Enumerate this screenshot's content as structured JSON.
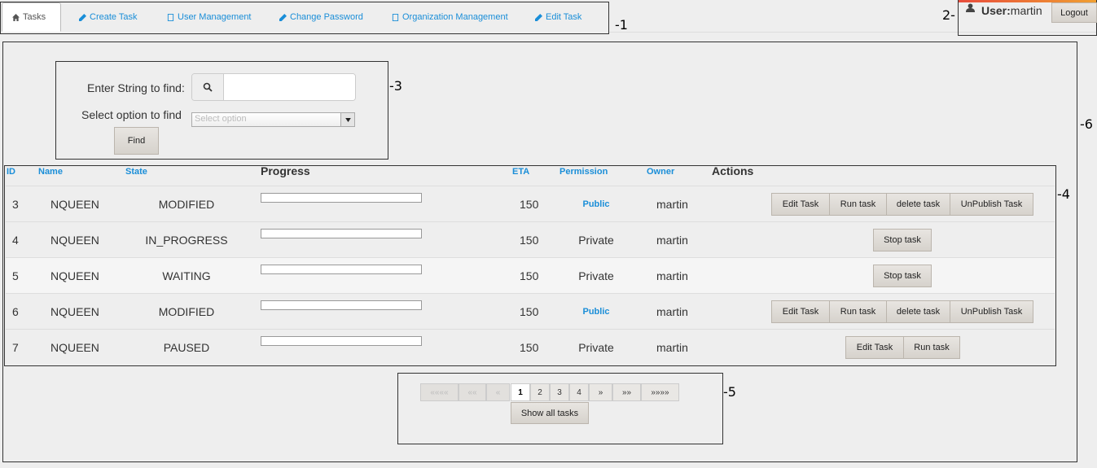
{
  "nav": {
    "tabs": [
      {
        "label": "Tasks",
        "icon": "home-icon"
      },
      {
        "label": "Create Task",
        "icon": "pencil-icon"
      },
      {
        "label": "User Management",
        "icon": "book-icon"
      },
      {
        "label": "Change Password",
        "icon": "pencil-icon"
      },
      {
        "label": "Organization Management",
        "icon": "book-icon"
      },
      {
        "label": "Edit Task",
        "icon": "pencil-icon"
      }
    ]
  },
  "user": {
    "prefix": "User:",
    "name": "martin",
    "logout_label": "Logout"
  },
  "search": {
    "string_label": "Enter String to find:",
    "option_label": "Select option to find",
    "select_placeholder": "Select option",
    "find_label": "Find"
  },
  "table": {
    "headers": {
      "id": "ID",
      "name": "Name",
      "state": "State",
      "progress": "Progress",
      "eta": "ETA",
      "permission": "Permission",
      "owner": "Owner",
      "actions": "Actions"
    },
    "rows": [
      {
        "id": "3",
        "name": "NQUEEN",
        "state": "MODIFIED",
        "progress": 0,
        "eta": "150",
        "permission": "Public",
        "owner": "martin",
        "actions": [
          "Edit Task",
          "Run task",
          "delete task",
          "UnPublish Task"
        ]
      },
      {
        "id": "4",
        "name": "NQUEEN",
        "state": "IN_PROGRESS",
        "progress": 0,
        "eta": "150",
        "permission": "Private",
        "owner": "martin",
        "actions": [
          "Stop task"
        ]
      },
      {
        "id": "5",
        "name": "NQUEEN",
        "state": "WAITING",
        "progress": 0,
        "eta": "150",
        "permission": "Private",
        "owner": "martin",
        "actions": [
          "Stop task"
        ]
      },
      {
        "id": "6",
        "name": "NQUEEN",
        "state": "MODIFIED",
        "progress": 0,
        "eta": "150",
        "permission": "Public",
        "owner": "martin",
        "actions": [
          "Edit Task",
          "Run task",
          "delete task",
          "UnPublish Task"
        ]
      },
      {
        "id": "7",
        "name": "NQUEEN",
        "state": "PAUSED",
        "progress": 0,
        "eta": "150",
        "permission": "Private",
        "owner": "martin",
        "actions": [
          "Edit Task",
          "Run task"
        ]
      }
    ]
  },
  "pagination": {
    "first": "««««",
    "prev_far": "««",
    "prev": "«",
    "pages": [
      "1",
      "2",
      "3",
      "4"
    ],
    "current": "1",
    "next": "»",
    "next_far": "»»",
    "last": "»»»»",
    "show_all_label": "Show all tasks"
  },
  "callouts": [
    "-1",
    "2-",
    "-3",
    "-4",
    "-5",
    "-6"
  ],
  "colors": {
    "link": "#1a8ed8",
    "button_bg": "#ddd9d4",
    "background": "#eeeeee"
  }
}
